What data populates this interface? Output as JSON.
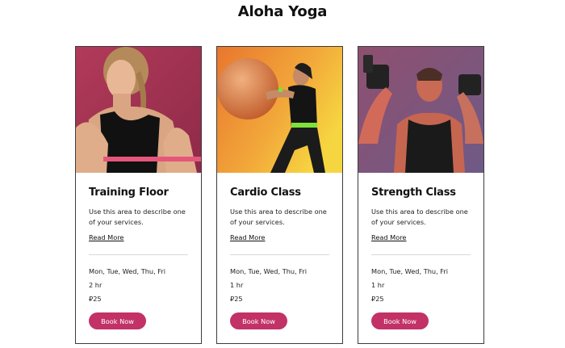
{
  "page": {
    "title": "Aloha Yoga"
  },
  "cards": [
    {
      "title": "Training Floor",
      "description": "Use this area to describe one of your services.",
      "link": "Read More",
      "days": "Mon, Tue, Wed, Thu, Fri",
      "duration": "2 hr",
      "price": "₽25",
      "button": "Book Now"
    },
    {
      "title": "Cardio Class",
      "description": "Use this area to describe one of your services.",
      "link": "Read More",
      "days": "Mon, Tue, Wed, Thu, Fri",
      "duration": "1 hr",
      "price": "₽25",
      "button": "Book Now"
    },
    {
      "title": "Strength Class",
      "description": "Use this area to describe one of your services.",
      "link": "Read More",
      "days": "Mon, Tue, Wed, Thu, Fri",
      "duration": "1 hr",
      "price": "₽25",
      "button": "Book Now"
    }
  ],
  "colors": {
    "button": "#c23266",
    "card_border": "#3c3c3c",
    "divider": "#d9d9d9"
  }
}
